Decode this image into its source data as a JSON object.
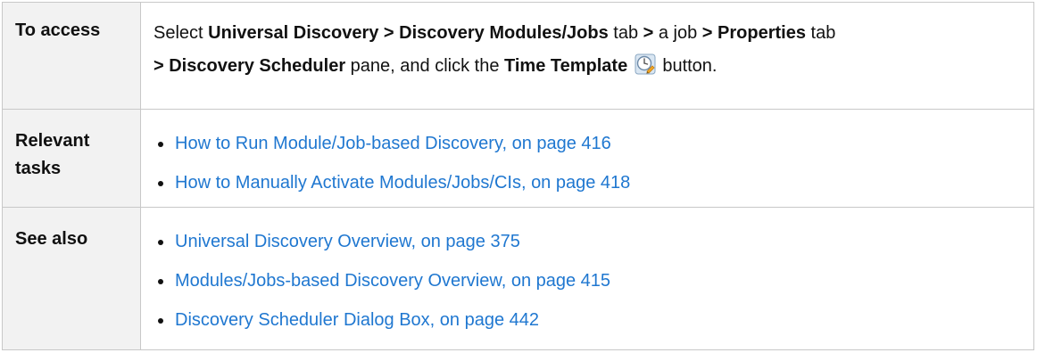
{
  "table": {
    "rows": {
      "access": {
        "label": "To access",
        "parts": {
          "p1": "Select ",
          "b1": "Universal Discovery > Discovery Modules/Jobs",
          "p2": " tab ",
          "b2": ">",
          "p3": " a job ",
          "b3": "> Properties",
          "p4": " tab",
          "b4": "> Discovery Scheduler",
          "p5": " pane, and click the ",
          "b5": "Time Template",
          "p6": " button."
        },
        "icon": "time-template-icon"
      },
      "tasks": {
        "label": "Relevant tasks",
        "items": [
          "How to Run Module/Job-based Discovery, on page 416",
          "How to Manually Activate Modules/Jobs/CIs, on page 418"
        ]
      },
      "see_also": {
        "label": "See also",
        "items": [
          "Universal Discovery Overview, on page 375",
          "Modules/Jobs-based Discovery Overview, on page 415",
          "Discovery Scheduler Dialog Box, on page 442"
        ]
      }
    },
    "colors": {
      "link": "#1f77d0",
      "label_background": "#f2f2f2",
      "border": "#c8c8c8"
    }
  }
}
